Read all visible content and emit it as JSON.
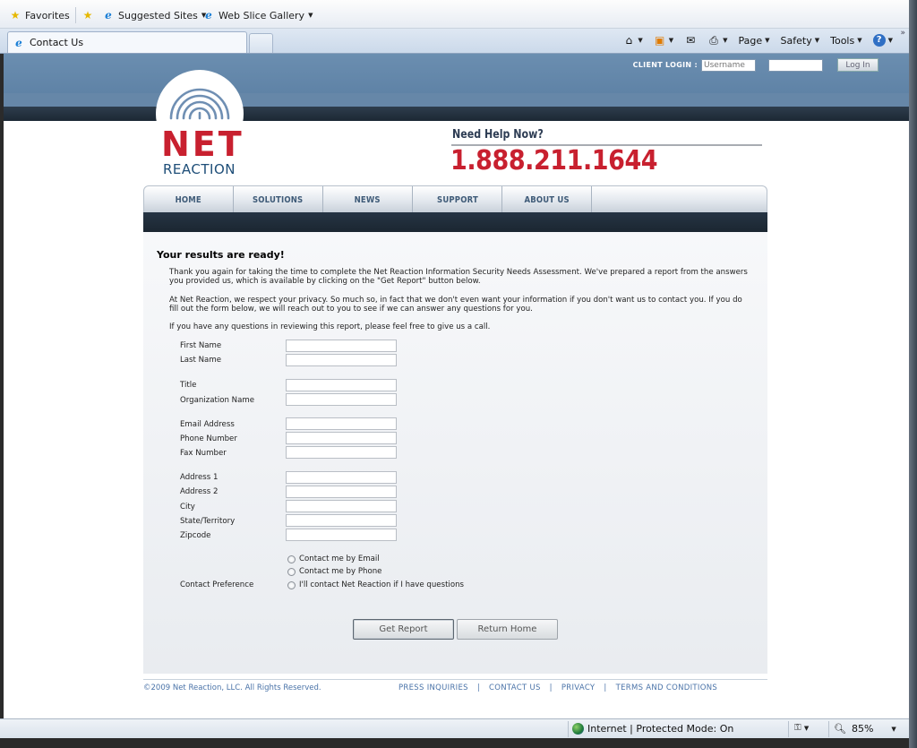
{
  "favorites_bar": {
    "favorites_label": "Favorites",
    "suggested_sites": "Suggested Sites",
    "web_slice_gallery": "Web Slice Gallery"
  },
  "tab": {
    "title": "Contact Us"
  },
  "command_bar": {
    "page": "Page",
    "safety": "Safety",
    "tools": "Tools"
  },
  "site": {
    "login": {
      "label": "CLIENT LOGIN :",
      "username_placeholder": "Username",
      "button": "Log In"
    },
    "logo": {
      "net": "NET",
      "reaction": "REACTION"
    },
    "help": {
      "label": "Need Help Now?",
      "phone": "1.888.211.1644"
    },
    "nav": [
      {
        "label": "HOME"
      },
      {
        "label": "SOLUTIONS"
      },
      {
        "label": "NEWS"
      },
      {
        "label": "SUPPORT"
      },
      {
        "label": "ABOUT US"
      }
    ],
    "content": {
      "heading": "Your results are ready!",
      "paragraph1": "Thank you again for taking the time to complete the Net Reaction Information Security Needs Assessment. We've prepared a report from the answers you provided us, which is available by clicking on the \"Get Report\" button below.",
      "paragraph2": "At Net Reaction, we respect your privacy. So much so, in fact that we don't even want your information if you don't want us to contact you. If you do fill out the form below, we will reach out to you to see if we can answer any questions for you.",
      "paragraph3": "If you have any questions in reviewing this report, please feel free to give us a call."
    },
    "form": {
      "first_name": "First Name",
      "last_name": "Last Name",
      "title": "Title",
      "organization_name": "Organization Name",
      "email_address": "Email Address",
      "phone_number": "Phone Number",
      "fax_number": "Fax Number",
      "address1": "Address 1",
      "address2": "Address 2",
      "city": "City",
      "state": "State/Territory",
      "zipcode": "Zipcode",
      "contact_preference": "Contact Preference",
      "radio_email": "Contact me by Email",
      "radio_phone": "Contact me by Phone",
      "radio_self": "I'll contact Net Reaction if I have questions",
      "get_report": "Get Report",
      "return_home": "Return Home"
    },
    "footer": {
      "copyright": "©2009 Net Reaction, LLC. All Rights Reserved.",
      "links": [
        "PRESS INQUIRIES",
        "CONTACT US",
        "PRIVACY",
        "TERMS AND CONDITIONS"
      ],
      "separator": "|"
    }
  },
  "status_bar": {
    "zone": "Internet | Protected Mode: On",
    "zoom": "85%"
  },
  "colors": {
    "brand_red": "#c8202f",
    "brand_navy": "#1e4e78",
    "header_blue": "#5b7fa3",
    "link_blue": "#4a73a8"
  }
}
